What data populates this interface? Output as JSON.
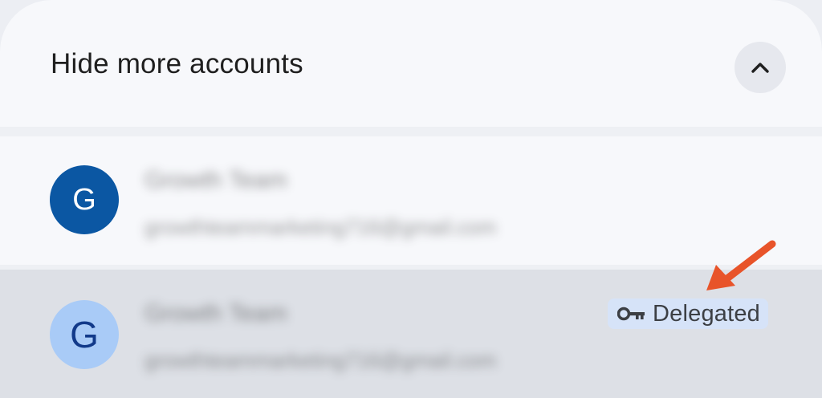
{
  "header": {
    "title": "Hide more accounts",
    "collapse_icon": "chevron-up-icon"
  },
  "accounts": [
    {
      "avatar_letter": "G",
      "name": "Growth Team",
      "email": "growthteammarketing716@gmail.com",
      "avatar_color": "#0b57a3"
    },
    {
      "avatar_letter": "G",
      "name": "Growth Team",
      "email": "growthteammarketing716@gmail.com",
      "avatar_color": "#a9cbf7",
      "badge": {
        "icon": "key-icon",
        "label": "Delegated"
      }
    }
  ],
  "annotation": {
    "arrow_color": "#e8542a",
    "icon": "arrow-icon"
  }
}
